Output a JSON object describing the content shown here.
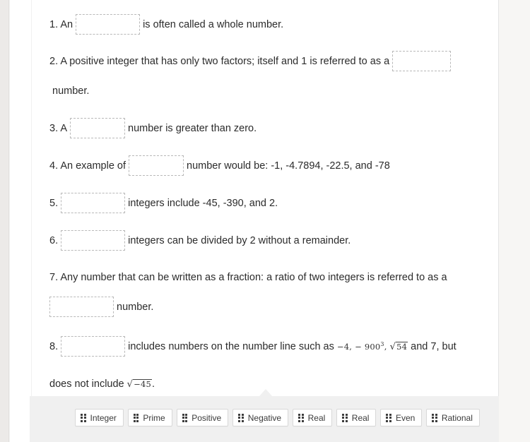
{
  "worksheet": {
    "questions": [
      {
        "id": "q1",
        "number": "1.",
        "before": "An",
        "after": "is often called a whole number.",
        "blank_placeholder": ""
      },
      {
        "id": "q2",
        "number": "2.",
        "before": "A positive integer that has only two factors; itself and 1 is referred to as a",
        "after": "number.",
        "blank_placeholder": ""
      },
      {
        "id": "q3",
        "number": "3.",
        "before": "A",
        "after": "number is greater than zero.",
        "blank_placeholder": ""
      },
      {
        "id": "q4",
        "number": "4.",
        "before": "An example of",
        "after": "number would be: -1, -4.7894, -22.5, and -78",
        "blank_placeholder": ""
      },
      {
        "id": "q5",
        "number": "5.",
        "before": "",
        "after": "integers include -45, -390, and 2.",
        "blank_placeholder": ""
      },
      {
        "id": "q6",
        "number": "6.",
        "before": "",
        "after": "integers can be divided by 2 without a remainder.",
        "blank_placeholder": ""
      },
      {
        "id": "q7",
        "number": "7.",
        "before": "Any number that can be written as a fraction: a ratio of two integers is referred to as a",
        "after": "number.",
        "blank_placeholder": ""
      },
      {
        "id": "q8",
        "number": "8.",
        "before": "",
        "after_part1": "includes numbers on the number line such as",
        "math1": "−4,",
        "math2_base": "− 900",
        "math2_exp": "3",
        "math2_tail": ",",
        "math3_radicand": "54",
        "after_part2": "and 7, but",
        "after_part3": "does not include",
        "math4_radicand": "−45",
        "after_part4": ".",
        "blank_placeholder": ""
      }
    ]
  },
  "tray": {
    "drag_handle_icon": "drag-handle-icon",
    "chips": [
      {
        "label": "Integer"
      },
      {
        "label": "Prime"
      },
      {
        "label": "Positive"
      },
      {
        "label": "Negative"
      },
      {
        "label": "Real"
      },
      {
        "label": "Real"
      },
      {
        "label": "Even"
      },
      {
        "label": "Rational"
      }
    ]
  },
  "colors": {
    "page_background": "#f4f4f3",
    "card_background": "#ffffff",
    "tray_background": "#f0f0f0",
    "blank_border": "#b9b9b9",
    "chip_border": "#d8d8d8",
    "text": "#2b2b2b"
  }
}
